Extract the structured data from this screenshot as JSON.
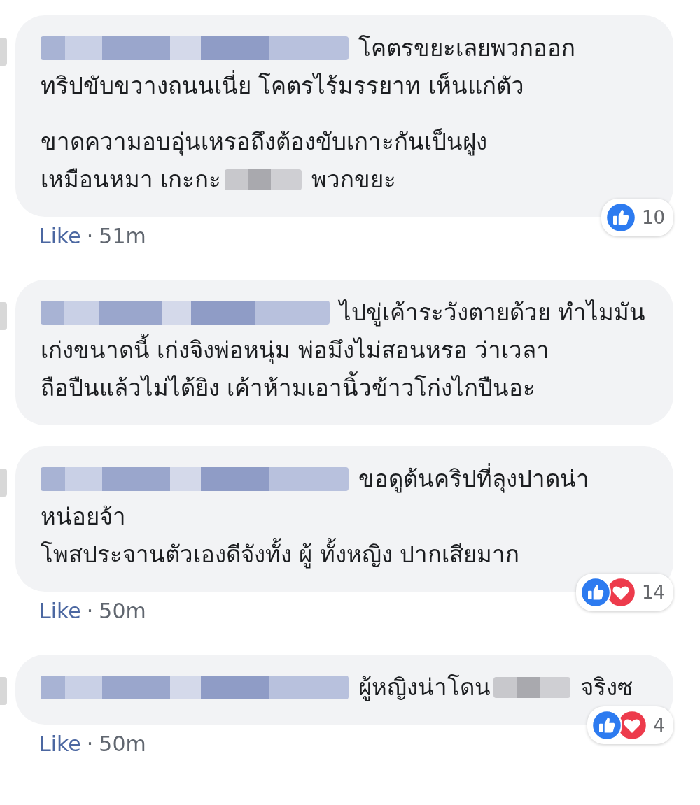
{
  "comments": [
    {
      "paragraphs": [
        [
          [
            {
              "kind": "name"
            },
            {
              "kind": "text",
              "text": "โคตรขยะเลยพวกออก"
            }
          ],
          [
            {
              "kind": "text",
              "text": "ทริปขับขวางถนนเนี่ย โคตรไร้มรรยาท เห็นแก่ตัว"
            }
          ]
        ],
        [
          [
            {
              "kind": "text",
              "text": "ขาดความอบอุ่นเหรอถึงต้องขับเกาะกันเป็นฝูง"
            }
          ],
          [
            {
              "kind": "text",
              "text": "เหมือนหมา เกะกะ"
            },
            {
              "kind": "redacted"
            },
            {
              "kind": "text",
              "text": "พวกขยะ"
            }
          ]
        ]
      ],
      "reactions": [
        {
          "kind": "like"
        }
      ],
      "reaction_count": "10",
      "like_label": "Like",
      "separator": "·",
      "time": "51m"
    },
    {
      "paragraphs": [
        [
          [
            {
              "kind": "name"
            },
            {
              "kind": "text",
              "text": "ไปขู่เค้าระวังตายด้วย ทำไมมัน"
            }
          ],
          [
            {
              "kind": "text",
              "text": "เก่งขนาดนี้ เก่งจิงพ่อหนุ่ม พ่อมึงไม่สอนหรอ ว่าเวลา"
            }
          ],
          [
            {
              "kind": "text",
              "text": "ถือปืนแล้วไม่ได้ยิง เค้าห้ามเอานิ้วข้าวโก่งไกปืนอะ"
            }
          ]
        ]
      ]
    },
    {
      "paragraphs": [
        [
          [
            {
              "kind": "name"
            },
            {
              "kind": "text",
              "text": "ขอดูต้นคริปที่ลุงปาดน่า"
            }
          ],
          [
            {
              "kind": "text",
              "text": "หน่อยจ้า"
            }
          ],
          [
            {
              "kind": "text",
              "text": "โพสประจานตัวเองดีจังทั้ง ผู้ ทั้งหญิง ปากเสียมาก"
            }
          ]
        ]
      ],
      "reactions": [
        {
          "kind": "like"
        },
        {
          "kind": "love"
        }
      ],
      "reaction_count": "14",
      "like_label": "Like",
      "separator": "·",
      "time": "50m"
    },
    {
      "paragraphs": [
        [
          [
            {
              "kind": "name"
            },
            {
              "kind": "text",
              "text": "ผู้หญิงน่าโดน"
            },
            {
              "kind": "redacted"
            },
            {
              "kind": "text",
              "text": "จริงซ"
            }
          ]
        ]
      ],
      "reactions": [
        {
          "kind": "like"
        },
        {
          "kind": "love"
        }
      ],
      "reaction_count": "4",
      "like_label": "Like",
      "separator": "·",
      "time": "50m"
    }
  ]
}
